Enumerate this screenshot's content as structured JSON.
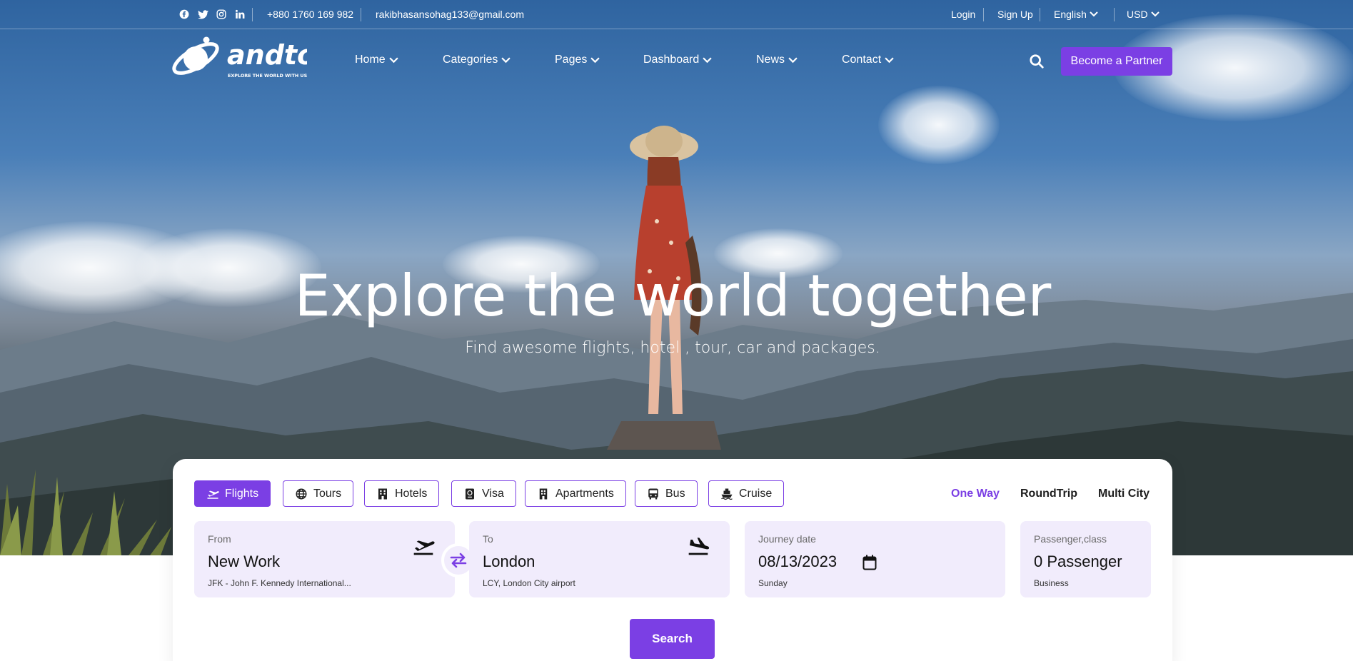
{
  "topbar": {
    "phone": "+880 1760 169 982",
    "email": "rakibhasansohag133@gmail.com",
    "login": "Login",
    "signup": "Sign Up",
    "language": "English",
    "currency": "USD",
    "social_icons": [
      "facebook-icon",
      "twitter-icon",
      "instagram-icon",
      "linkedin-icon"
    ]
  },
  "logo": {
    "name": "andtour",
    "tagline": "EXPLORE THE WORLD WITH US"
  },
  "nav": {
    "items": [
      "Home",
      "Categories",
      "Pages",
      "Dashboard",
      "News",
      "Contact"
    ],
    "partner_button": "Become a Partner"
  },
  "hero": {
    "title": "Explore the world together",
    "subtitle": "Find awesome flights, hotel , tour, car and packages."
  },
  "search": {
    "tabs": [
      "Flights",
      "Tours",
      "Hotels",
      "Visa",
      "Apartments",
      "Bus",
      "Cruise"
    ],
    "active_tab": "Flights",
    "trip_types": [
      "One Way",
      "RoundTrip",
      "Multi City"
    ],
    "active_trip": "One Way",
    "from": {
      "label": "From",
      "value": "New Work",
      "sub": "JFK - John F. Kennedy International..."
    },
    "to": {
      "label": "To",
      "value": "London",
      "sub": "LCY, London City airport"
    },
    "date": {
      "label": "Journey date",
      "value": "08/13/2023",
      "sub": "Sunday"
    },
    "passenger": {
      "label": "Passenger,class",
      "value": "0 Passenger",
      "sub": "Business"
    },
    "button": "Search"
  },
  "colors": {
    "accent": "#7b3fe4",
    "field_bg": "#f1ecfc"
  }
}
